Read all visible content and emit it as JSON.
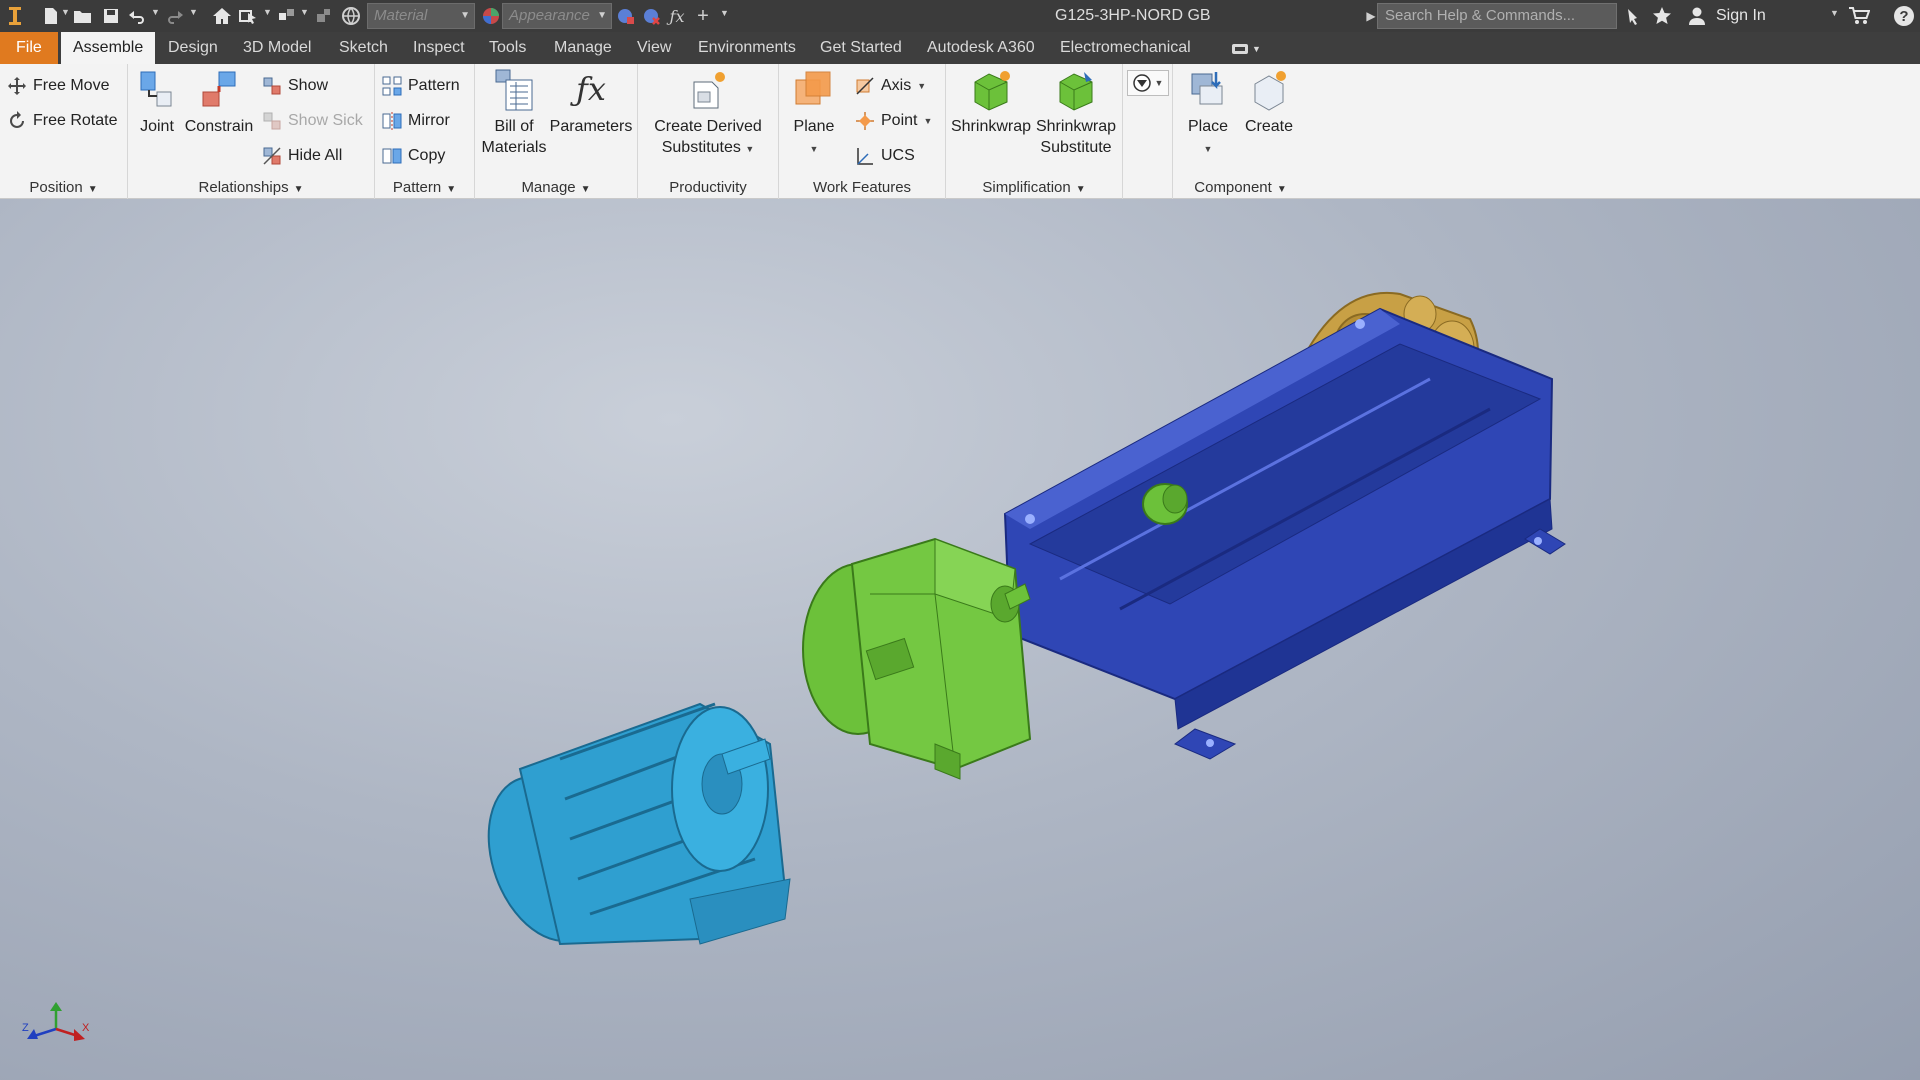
{
  "app": {
    "document_title": "G125-3HP-NORD GB",
    "material_placeholder": "Material",
    "appearance_placeholder": "Appearance",
    "search_placeholder": "Search Help & Commands...",
    "signin_label": "Sign In"
  },
  "tabs": [
    {
      "label": "File"
    },
    {
      "label": "Assemble"
    },
    {
      "label": "Design"
    },
    {
      "label": "3D Model"
    },
    {
      "label": "Sketch"
    },
    {
      "label": "Inspect"
    },
    {
      "label": "Tools"
    },
    {
      "label": "Manage"
    },
    {
      "label": "View"
    },
    {
      "label": "Environments"
    },
    {
      "label": "Get Started"
    },
    {
      "label": "Autodesk A360"
    },
    {
      "label": "Electromechanical"
    }
  ],
  "ribbon": {
    "position": {
      "title": "Position",
      "free_move": "Free Move",
      "free_rotate": "Free Rotate"
    },
    "relationships": {
      "title": "Relationships",
      "joint": "Joint",
      "constrain": "Constrain",
      "show": "Show",
      "show_sick": "Show Sick",
      "hide_all": "Hide All"
    },
    "pattern": {
      "title": "Pattern",
      "pattern": "Pattern",
      "mirror": "Mirror",
      "copy": "Copy"
    },
    "manage": {
      "title": "Manage",
      "bom_line1": "Bill of",
      "bom_line2": "Materials",
      "parameters": "Parameters"
    },
    "productivity": {
      "title": "Productivity",
      "cds_line1": "Create Derived",
      "cds_line2": "Substitutes"
    },
    "work_features": {
      "title": "Work Features",
      "plane": "Plane",
      "axis": "Axis",
      "point": "Point",
      "ucs": "UCS"
    },
    "simplification": {
      "title": "Simplification",
      "shrinkwrap": "Shrinkwrap",
      "sws_line1": "Shrinkwrap",
      "sws_line2": "Substitute"
    },
    "component": {
      "title": "Component",
      "place": "Place",
      "create": "Create"
    }
  },
  "triad": {
    "z": "Z",
    "x": "X"
  },
  "colors": {
    "file_tab": "#e07a1f",
    "motor": "#2f9fd0",
    "gearbox": "#6cc13a",
    "frame": "#2f46b5",
    "pump": "#c8a045"
  }
}
